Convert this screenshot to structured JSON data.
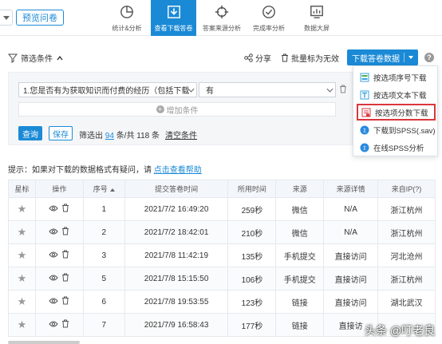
{
  "topbar": {
    "preview_label": "预览问卷",
    "tabs": [
      {
        "label": "统计&分析",
        "icon": "pie-chart-icon",
        "active": false
      },
      {
        "label": "查看下载答卷",
        "icon": "download-icon",
        "active": true
      },
      {
        "label": "答案来源分析",
        "icon": "crosshair-icon",
        "active": false
      },
      {
        "label": "完成率分析",
        "icon": "check-circle-icon",
        "active": false
      },
      {
        "label": "数据大屏",
        "icon": "dashboard-icon",
        "active": false
      }
    ]
  },
  "filter": {
    "title": "筛选条件",
    "condition": "1.您是否有为获取知识而付费的经历（包括下载",
    "value": "有",
    "add_label": "增加条件",
    "query_label": "查询",
    "save_label": "保存",
    "result_prefix": "筛选出",
    "result_count": "94",
    "result_suffix": "条/共 118 条",
    "clear_label": "清空条件"
  },
  "toolbar": {
    "share_label": "分享",
    "invalid_label": "批量标为无效",
    "download_label": "下载答卷数据",
    "help": "?"
  },
  "menu": {
    "items": [
      {
        "label": "按选项序号下载",
        "icon": "list-icon",
        "highlighted": false
      },
      {
        "label": "按选项文本下载",
        "icon": "text-doc-icon",
        "highlighted": false
      },
      {
        "label": "按选项分数下载",
        "icon": "score-doc-icon",
        "highlighted": true
      },
      {
        "label": "下载到SPSS(.sav)",
        "icon": "spss-icon",
        "highlighted": false
      },
      {
        "label": "在线SPSS分析",
        "icon": "spss-online-icon",
        "highlighted": false
      }
    ]
  },
  "tip": {
    "text": "提示：如果对下载的数据格式有疑问，请",
    "link": "点击查看帮助"
  },
  "table": {
    "headers": [
      "星标",
      "操作",
      "序号",
      "提交答卷时间",
      "所用时间",
      "来源",
      "来源详情",
      "来自IP(?)"
    ],
    "rows": [
      {
        "id": "1",
        "time": "2021/7/2 16:49:20",
        "duration": "259秒",
        "source": "微信",
        "detail": "N/A",
        "ip": "浙江杭州"
      },
      {
        "id": "2",
        "time": "2021/7/2 18:42:01",
        "duration": "210秒",
        "source": "微信",
        "detail": "N/A",
        "ip": "浙江杭州"
      },
      {
        "id": "3",
        "time": "2021/7/8 11:42:19",
        "duration": "135秒",
        "source": "手机提交",
        "detail": "直接访问",
        "ip": "河北沧州"
      },
      {
        "id": "5",
        "time": "2021/7/8 15:15:50",
        "duration": "106秒",
        "source": "手机提交",
        "detail": "直接访问",
        "ip": "浙江杭州"
      },
      {
        "id": "6",
        "time": "2021/7/8 19:53:55",
        "duration": "123秒",
        "source": "链接",
        "detail": "直接访问",
        "ip": "湖北武汉"
      },
      {
        "id": "7",
        "time": "2021/7/9 16:58:43",
        "duration": "177秒",
        "source": "链接",
        "detail": "直接访",
        "ip": ""
      }
    ]
  },
  "watermark": "头条 @叮老良",
  "colors": {
    "accent": "#1b8ad6",
    "highlight": "#d9363e"
  }
}
